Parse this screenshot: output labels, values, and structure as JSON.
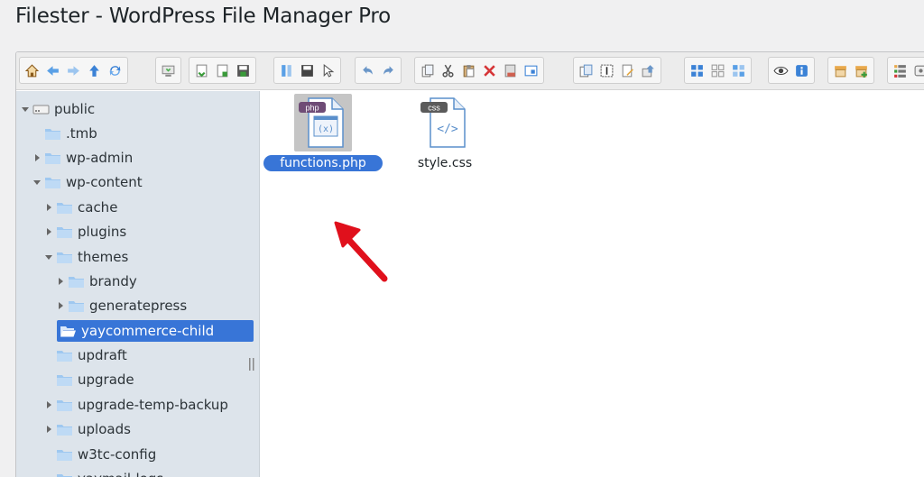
{
  "page": {
    "title": "Filester - WordPress File Manager Pro"
  },
  "tree": {
    "items": [
      {
        "label": "public",
        "arrow": "expanded",
        "icon": "drive-icon"
      },
      {
        "label": ".tmb",
        "arrow": "none",
        "icon": "folder-icon"
      },
      {
        "label": "wp-admin",
        "arrow": "collapsed",
        "icon": "folder-icon"
      },
      {
        "label": "wp-content",
        "arrow": "expanded",
        "icon": "folder-icon"
      },
      {
        "label": "cache",
        "arrow": "collapsed",
        "icon": "folder-icon"
      },
      {
        "label": "plugins",
        "arrow": "collapsed",
        "icon": "folder-icon"
      },
      {
        "label": "themes",
        "arrow": "expanded",
        "icon": "folder-icon"
      },
      {
        "label": "brandy",
        "arrow": "collapsed",
        "icon": "folder-icon"
      },
      {
        "label": "generatepress",
        "arrow": "collapsed",
        "icon": "folder-icon"
      },
      {
        "label": "yaycommerce-child",
        "arrow": "none",
        "icon": "folder-open-icon",
        "selected": true
      },
      {
        "label": "updraft",
        "arrow": "none",
        "icon": "folder-icon"
      },
      {
        "label": "upgrade",
        "arrow": "none",
        "icon": "folder-icon"
      },
      {
        "label": "upgrade-temp-backup",
        "arrow": "collapsed",
        "icon": "folder-icon"
      },
      {
        "label": "uploads",
        "arrow": "collapsed",
        "icon": "folder-icon"
      },
      {
        "label": "w3tc-config",
        "arrow": "none",
        "icon": "folder-icon"
      },
      {
        "label": "yaymail-logs",
        "arrow": "none",
        "icon": "folder-icon"
      }
    ]
  },
  "files": {
    "items": [
      {
        "name": "functions.php",
        "badge": "php",
        "badge_color": "#6f4c76",
        "glyph": "(x)",
        "selected": true
      },
      {
        "name": "style.css",
        "badge": "css",
        "badge_color": "#5b5b5b",
        "glyph": "</>",
        "selected": false
      }
    ]
  },
  "toolbar": {
    "icons": [
      "home-icon",
      "back-icon",
      "forward-icon",
      "up-icon",
      "reload-icon",
      "netmount-icon",
      "open-icon",
      "download-icon",
      "save-icon",
      "places-icon",
      "save-file-icon",
      "select-icon",
      "undo-icon",
      "redo-icon",
      "copy-icon",
      "cut-icon",
      "paste-icon",
      "delete-icon",
      "empty-icon",
      "resize-icon",
      "duplicate-icon",
      "rename-icon",
      "edit-icon",
      "extract-icon",
      "view-list-icon",
      "view-small-icon",
      "view-large-icon",
      "preview-icon",
      "info-icon",
      "archive-icon",
      "add-archive-icon",
      "sort-icon",
      "settings-icon"
    ]
  },
  "colors": {
    "accent": "#3875d7",
    "tree_bg": "#dde4eb",
    "annotation": "#e0101c"
  }
}
